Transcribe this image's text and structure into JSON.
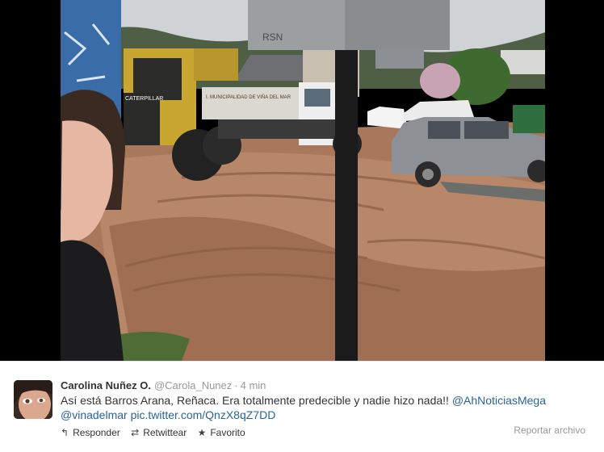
{
  "media": {
    "photo_texts": {
      "truck_side_text": "I. MUNICIPALIDAD DE VIÑA DEL MAR",
      "loader_brand": "CATERPILLAR"
    }
  },
  "tweet": {
    "fullname": "Carolina Nuñez O.",
    "username": "@Carola_Nunez",
    "separator": "·",
    "time": "4 min",
    "text_plain": "Así está Barros Arana, Reñaca. Era totalmente predecible y nadie hizo nada!! ",
    "mention_1": "@AhNoticiasMega",
    "mention_2": "@vinadelmar",
    "pic_link": "pic.twitter.com/QnzX8qZ7DD",
    "actions": {
      "reply_icon": "reply-icon",
      "reply_label": "Responder",
      "retweet_icon": "retweet-icon",
      "retweet_label": "Retwittear",
      "favorite_icon": "star-icon",
      "favorite_label": "Favorito"
    },
    "report_label": "Reportar archivo"
  },
  "colors": {
    "link": "#2a6496",
    "meta": "#999999",
    "text": "#333333",
    "mud": "#a9775a",
    "frame": "#000000"
  }
}
